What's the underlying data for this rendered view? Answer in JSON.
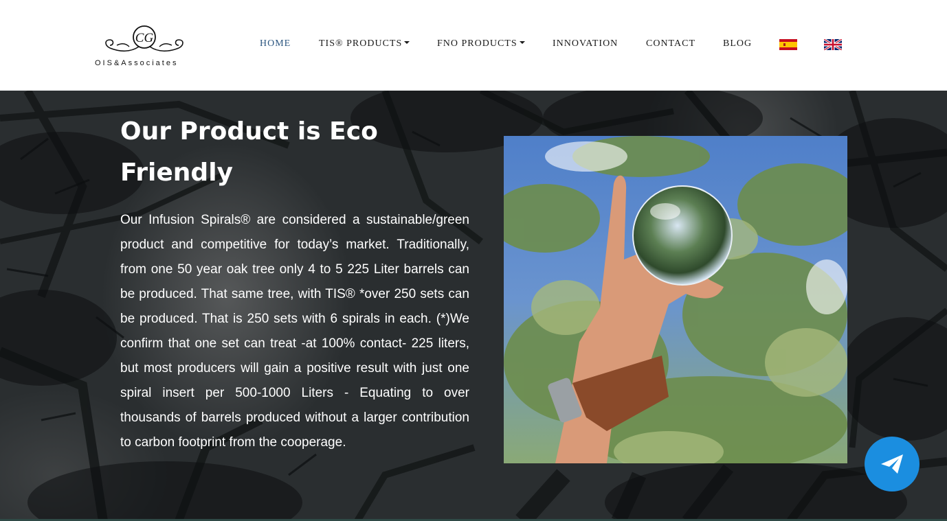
{
  "header": {
    "logo": {
      "monogram": "CG",
      "name": "OIS&Associates"
    },
    "nav": [
      {
        "label": "HOME",
        "active": true,
        "dropdown": false
      },
      {
        "label": "TIS® PRODUCTS",
        "active": false,
        "dropdown": true
      },
      {
        "label": "FNO PRODUCTS",
        "active": false,
        "dropdown": true
      },
      {
        "label": "INNOVATION",
        "active": false,
        "dropdown": false
      },
      {
        "label": "CONTACT",
        "active": false,
        "dropdown": false
      },
      {
        "label": "BLOG",
        "active": false,
        "dropdown": false
      }
    ],
    "languages": [
      "spanish-flag-icon",
      "uk-flag-icon"
    ]
  },
  "hero": {
    "title": "Our Product is Eco Friendly",
    "body": "Our Infusion Spirals® are considered a sustainable/green product and competitive for today’s market. Traditionally, from one 50 year oak tree only 4 to 5 225 Liter barrels can be produced. That same tree, with TIS® *over 250 sets can be produced. That is 250 sets with 6 spirals in each. (*)We confirm that one set can treat -at 100% contact- 225 liters, but most producers will gain a positive result with just one spiral insert per 500-1000 Liters - Equating to over thousands of barrels produced without a larger contribution to carbon footprint from the cooperage.",
    "photo_icon": "hand-holding-crystal-ball-photo"
  },
  "floating_button": {
    "icon": "paper-plane-icon"
  },
  "colors": {
    "nav_active": "#2c5680",
    "send_button": "#1b8ee0",
    "header_bg": "#ffffff"
  }
}
